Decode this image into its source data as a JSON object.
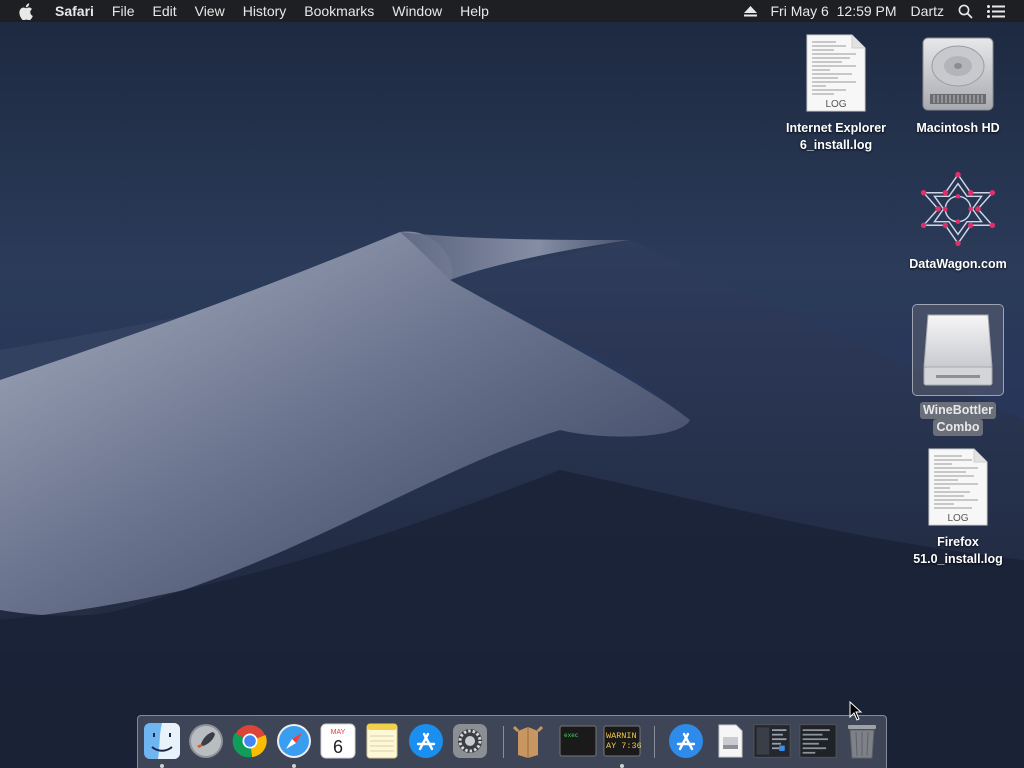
{
  "menubar": {
    "app_name": "Safari",
    "menus": [
      "File",
      "Edit",
      "View",
      "History",
      "Bookmarks",
      "Window",
      "Help"
    ],
    "clock": "Fri May 6  12:59 PM",
    "user": "Dartz"
  },
  "desktop": {
    "icons": [
      {
        "name": "Internet Explorer 6_install.log",
        "line1": "Internet Explorer",
        "line2": "6_install.log",
        "badge": "LOG",
        "kind": "log-file-icon"
      },
      {
        "name": "Macintosh HD",
        "line1": "Macintosh HD",
        "line2": "",
        "kind": "hard-drive-icon"
      },
      {
        "name": "DataWagon.com",
        "line1": "DataWagon.com",
        "line2": "",
        "kind": "datawagon-icon"
      },
      {
        "name": "WineBottler Combo",
        "line1": "WineBottler",
        "line2": "Combo",
        "kind": "disk-image-icon",
        "selected": true
      },
      {
        "name": "Firefox 51.0_install.log",
        "line1": "Firefox",
        "line2": "51.0_install.log",
        "badge": "LOG",
        "kind": "log-file-icon"
      }
    ]
  },
  "dock": {
    "items": [
      {
        "name": "Finder",
        "running": true
      },
      {
        "name": "Launchpad",
        "running": false
      },
      {
        "name": "Google Chrome",
        "running": false
      },
      {
        "name": "Safari",
        "running": true
      },
      {
        "name": "Calendar",
        "month": "MAY",
        "day": "6",
        "running": false
      },
      {
        "name": "Notes",
        "running": false
      },
      {
        "name": "App Store",
        "running": false
      },
      {
        "name": "System Preferences",
        "running": false
      },
      {
        "name": "Archive Utility",
        "running": false
      },
      {
        "name": "Terminal",
        "text": "exec",
        "running": false
      },
      {
        "name": "Console",
        "text1": "WARNIN",
        "text2": "AY 7:36",
        "running": true
      },
      {
        "name": "Applications folder",
        "running": false
      },
      {
        "name": "Document",
        "running": false
      },
      {
        "name": "Screenshot 1",
        "running": false
      },
      {
        "name": "Screenshot 2",
        "running": false
      },
      {
        "name": "Trash",
        "running": false
      }
    ]
  },
  "colors": {
    "menubar_bg": "#1e1e20",
    "wallpaper_sky": "#25324a",
    "dune_light": "#8a93a8"
  }
}
